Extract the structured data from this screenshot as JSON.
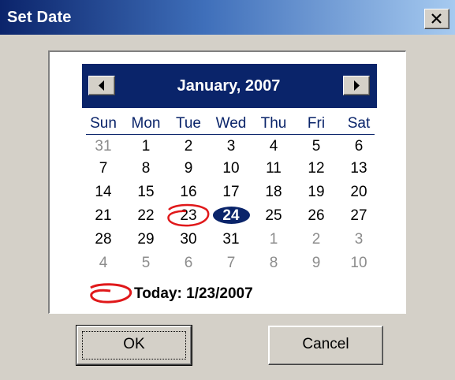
{
  "window": {
    "title": "Set Date",
    "close_glyph": "x",
    "colors": {
      "title_gradient_start": "#0b246b",
      "title_gradient_end": "#a6caf0",
      "face": "#d4d0c8",
      "calendar_accent": "#0a246a",
      "today_marker": "#e0181a"
    }
  },
  "calendar": {
    "month_label": "January, 2007",
    "prev_icon": "left-arrow-icon",
    "next_icon": "right-arrow-icon",
    "weekdays": [
      "Sun",
      "Mon",
      "Tue",
      "Wed",
      "Thu",
      "Fri",
      "Sat"
    ],
    "weeks": [
      [
        {
          "d": "31",
          "other": true
        },
        {
          "d": "1"
        },
        {
          "d": "2"
        },
        {
          "d": "3"
        },
        {
          "d": "4"
        },
        {
          "d": "5"
        },
        {
          "d": "6"
        }
      ],
      [
        {
          "d": "7"
        },
        {
          "d": "8"
        },
        {
          "d": "9"
        },
        {
          "d": "10"
        },
        {
          "d": "11"
        },
        {
          "d": "12"
        },
        {
          "d": "13"
        }
      ],
      [
        {
          "d": "14"
        },
        {
          "d": "15"
        },
        {
          "d": "16"
        },
        {
          "d": "17"
        },
        {
          "d": "18"
        },
        {
          "d": "19"
        },
        {
          "d": "20"
        }
      ],
      [
        {
          "d": "21"
        },
        {
          "d": "22"
        },
        {
          "d": "23",
          "today": true
        },
        {
          "d": "24",
          "selected": true
        },
        {
          "d": "25"
        },
        {
          "d": "26"
        },
        {
          "d": "27"
        }
      ],
      [
        {
          "d": "28"
        },
        {
          "d": "29"
        },
        {
          "d": "30"
        },
        {
          "d": "31"
        },
        {
          "d": "1",
          "other": true
        },
        {
          "d": "2",
          "other": true
        },
        {
          "d": "3",
          "other": true
        }
      ],
      [
        {
          "d": "4",
          "other": true
        },
        {
          "d": "5",
          "other": true
        },
        {
          "d": "6",
          "other": true
        },
        {
          "d": "7",
          "other": true
        },
        {
          "d": "8",
          "other": true
        },
        {
          "d": "9",
          "other": true
        },
        {
          "d": "10",
          "other": true
        }
      ]
    ],
    "today_label": "Today: 1/23/2007"
  },
  "buttons": {
    "ok": "OK",
    "cancel": "Cancel"
  }
}
